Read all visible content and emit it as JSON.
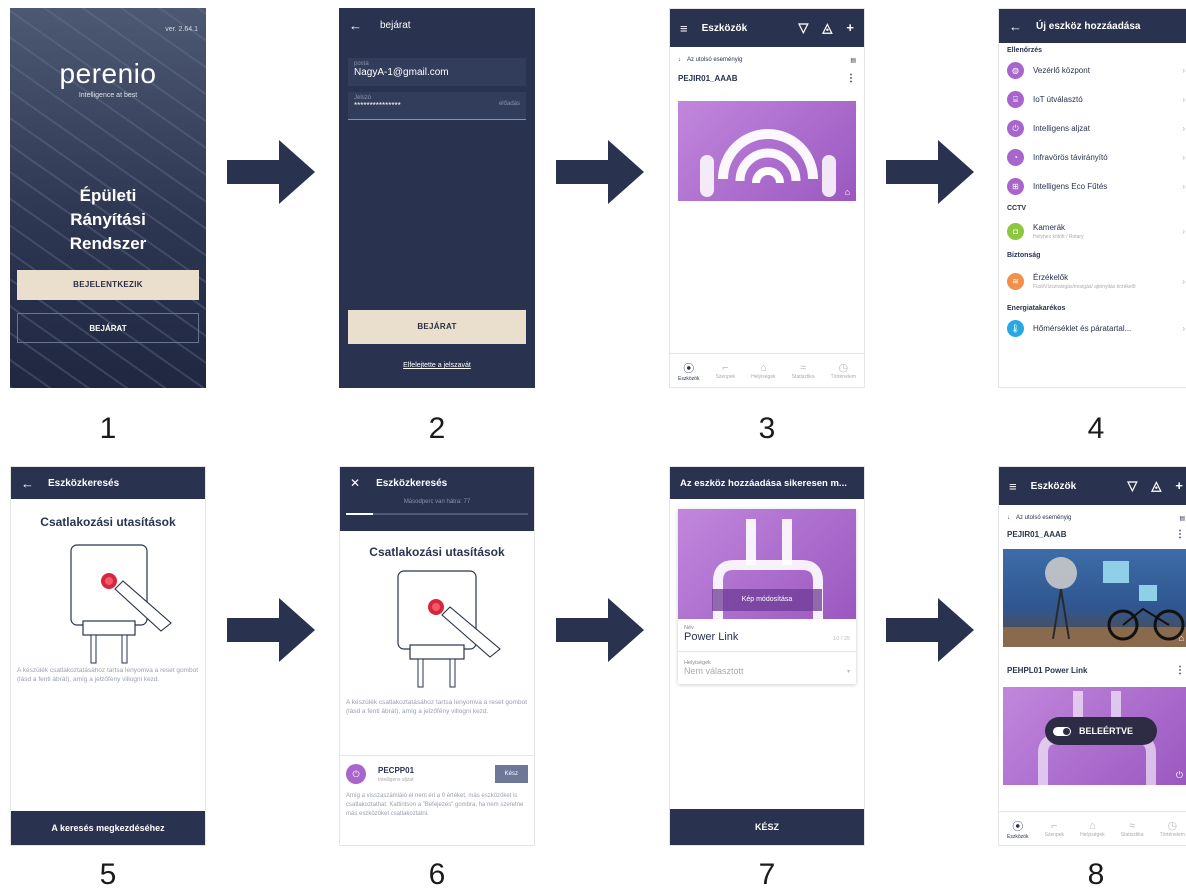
{
  "steps": [
    "1",
    "2",
    "3",
    "4",
    "5",
    "6",
    "7",
    "8"
  ],
  "colors": {
    "navy": "#29334f",
    "purple": "#a866cc",
    "beige": "#e9dfcc",
    "arrow": "#29334f"
  },
  "s1": {
    "version": "ver. 2.64.1",
    "logo": "perenio",
    "tagline": "Intelligence at best",
    "title_lines": [
      "Épületi",
      "Rányítási",
      "Rendszer"
    ],
    "login_button": "BEJELENTKEZIK",
    "enter_button": "BEJÁRAT"
  },
  "s2": {
    "back_icon": "arrow-left-icon",
    "title": "bejárat",
    "email_label": "posta",
    "email_value": "NagyA-1@gmail.com",
    "password_label": "Jelszó",
    "password_value": "***************",
    "show_label": "előadás",
    "enter_button": "BEJÁRAT",
    "forgot_link": "Elfelejtette a jelszavát"
  },
  "s3": {
    "title": "Eszközök",
    "filter_label": "Az utolsó eseményig",
    "device_name": "PEJIR01_AAAB",
    "nav": [
      "Eszközök",
      "Szenpek",
      "Helyiségek",
      "Statisztika",
      "Történelem"
    ]
  },
  "s4": {
    "title": "Új eszköz hozzáadása",
    "sections": [
      {
        "name": "Ellenőrzés",
        "items": [
          {
            "label": "Vezérlő központ",
            "sub": "",
            "color": "#a866cc",
            "icon": "hub-icon"
          },
          {
            "label": "IoT útválasztó",
            "sub": "",
            "color": "#a866cc",
            "icon": "router-icon"
          },
          {
            "label": "Intelligens aljzat",
            "sub": "",
            "color": "#a866cc",
            "icon": "plug-icon"
          },
          {
            "label": "Infravörös távirányító",
            "sub": "",
            "color": "#a866cc",
            "icon": "ir-remote-icon"
          },
          {
            "label": "Intelligens Eco Fűtés",
            "sub": "",
            "color": "#a866cc",
            "icon": "heater-icon"
          }
        ]
      },
      {
        "name": "CCTV",
        "items": [
          {
            "label": "Kamerák",
            "sub": "Helyhez kötött / Rotary",
            "color": "#8dc63f",
            "icon": "camera-icon"
          }
        ]
      },
      {
        "name": "Biztonság",
        "items": [
          {
            "label": "Érzékelők",
            "sub": "Füst/Vízszivárgás/mozgás/ ajtónyitás érzékelő",
            "color": "#f0904a",
            "icon": "sensor-icon"
          }
        ]
      },
      {
        "name": "Energiatakarékos",
        "items": [
          {
            "label": "Hőmérséklet és páratartal...",
            "sub": "",
            "color": "#29a7e1",
            "icon": "thermometer-icon"
          }
        ]
      }
    ]
  },
  "s5": {
    "title": "Eszközkeresés",
    "heading": "Csatlakozási utasítások",
    "instructions": "A készülék csatlakoztatásához tartsa lenyomva a reset gombot (lásd a fenti ábrát), amíg a jelzőfény villogni kezd.",
    "search_button": "A keresés megkezdéséhez"
  },
  "s6": {
    "title": "Eszközkeresés",
    "countdown": "Másodperc van hátra: 77",
    "progress": 0.15,
    "heading": "Csatlakozási utasítások",
    "instructions": "A készülék csatlakoztatásához tartsa lenyomva a reset gombot (lásd a fenti ábrát), amíg a jelzőfény villogni kezd.",
    "device_name": "PECPP01",
    "device_type": "Intelligens aljzat",
    "done_button": "Kész",
    "footer_text": "Amíg a visszaszámláló el nem éri a 0 értéket, más eszközöket is csatlakoztathat. Kattintson a \"Befejezés\" gombra, ha nem szeretne más eszközöket csatlakoztatni."
  },
  "s7": {
    "title": "Az eszköz hozzáadása sikeresen m...",
    "change_image": "Kép módosítása",
    "name_label": "Név",
    "name_value": "Power Link",
    "name_counter": "10 / 25",
    "rooms_label": "Helyiségek",
    "rooms_value": "Nem választott",
    "done_button": "KÉSZ"
  },
  "s8": {
    "title": "Eszközök",
    "filter_label": "Az utolsó eseményig",
    "device1": "PEJIR01_AAAB",
    "device2": "PEHPL01 Power Link",
    "toggle_label": "BELEÉRTVE",
    "nav": [
      "Eszközök",
      "Szenpek",
      "Helyiségek",
      "Statisztika",
      "Történelem"
    ]
  }
}
